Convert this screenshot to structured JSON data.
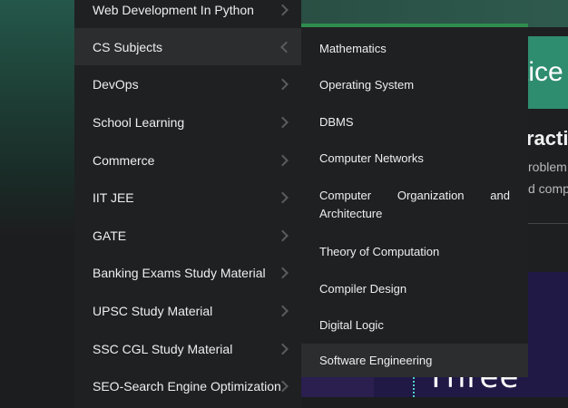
{
  "background": {
    "practice_button": "tice",
    "heading": "ractic",
    "text_lines": [
      "roblem",
      "d comp"
    ],
    "hero_word": "Three"
  },
  "menu": {
    "items": [
      {
        "label": "Web Development In Python"
      },
      {
        "label": "CS Subjects",
        "active": true
      },
      {
        "label": "DevOps"
      },
      {
        "label": "School Learning"
      },
      {
        "label": "Commerce"
      },
      {
        "label": "IIT JEE"
      },
      {
        "label": "GATE"
      },
      {
        "label": "Banking Exams Study Material"
      },
      {
        "label": "UPSC Study Material"
      },
      {
        "label": "SSC CGL Study Material"
      },
      {
        "label": "SEO-Search Engine Optimization"
      }
    ]
  },
  "submenu": {
    "accent_color": "#2f8d4e",
    "items": [
      {
        "label": "Mathematics"
      },
      {
        "label": "Operating System"
      },
      {
        "label": "DBMS"
      },
      {
        "label": "Computer Networks"
      },
      {
        "label_line1_words": [
          "Computer",
          "Organization",
          "and"
        ],
        "label_line2": "Architecture",
        "label": "Computer Organization and Architecture"
      },
      {
        "label": "Theory of Computation"
      },
      {
        "label": "Compiler Design"
      },
      {
        "label": "Digital Logic"
      },
      {
        "label": "Software Engineering",
        "highlighted": true
      }
    ]
  }
}
